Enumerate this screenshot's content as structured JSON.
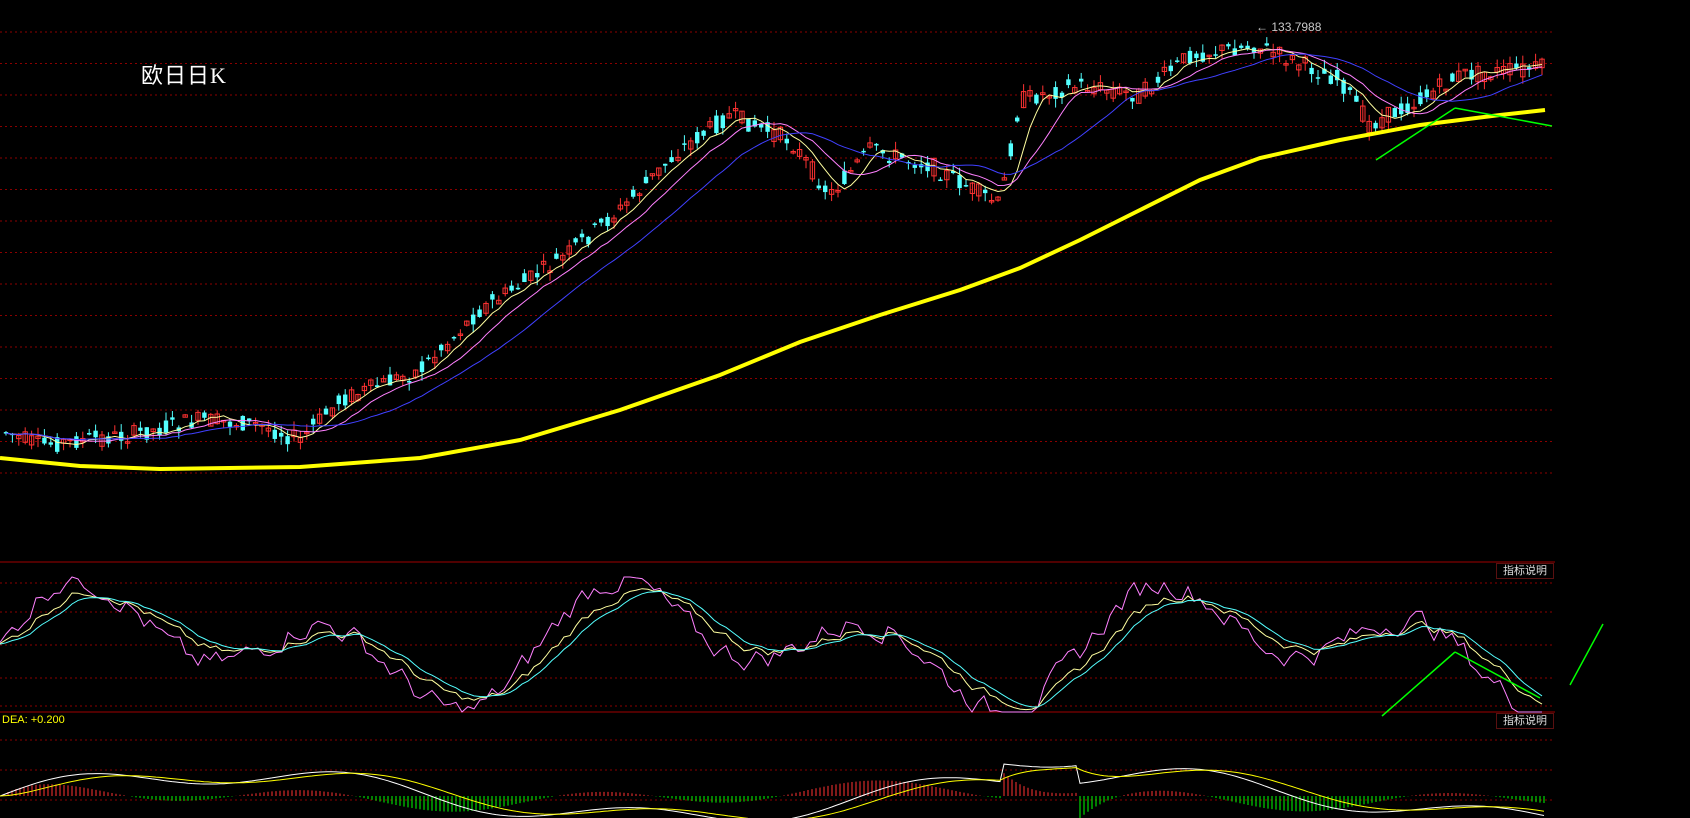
{
  "chart_data": {
    "type": "candlestick",
    "title": "欧日日K",
    "max_label": "133.7988",
    "indicator_button_label": "指标说明",
    "dea_label": "DEA: +0.200",
    "colors": {
      "up": "#ff3232",
      "down": "#54ffff",
      "ma_fast": "#ffffa0",
      "ma_mid": "#ff80ff",
      "ma_slow": "#4040ff",
      "ma_long": "#ffff00",
      "grid": "#8b0000",
      "trendline": "#00ff00"
    },
    "candles_approx": 240,
    "kdj_range": [
      0,
      100
    ],
    "note_price_range": [
      117,
      134
    ]
  }
}
